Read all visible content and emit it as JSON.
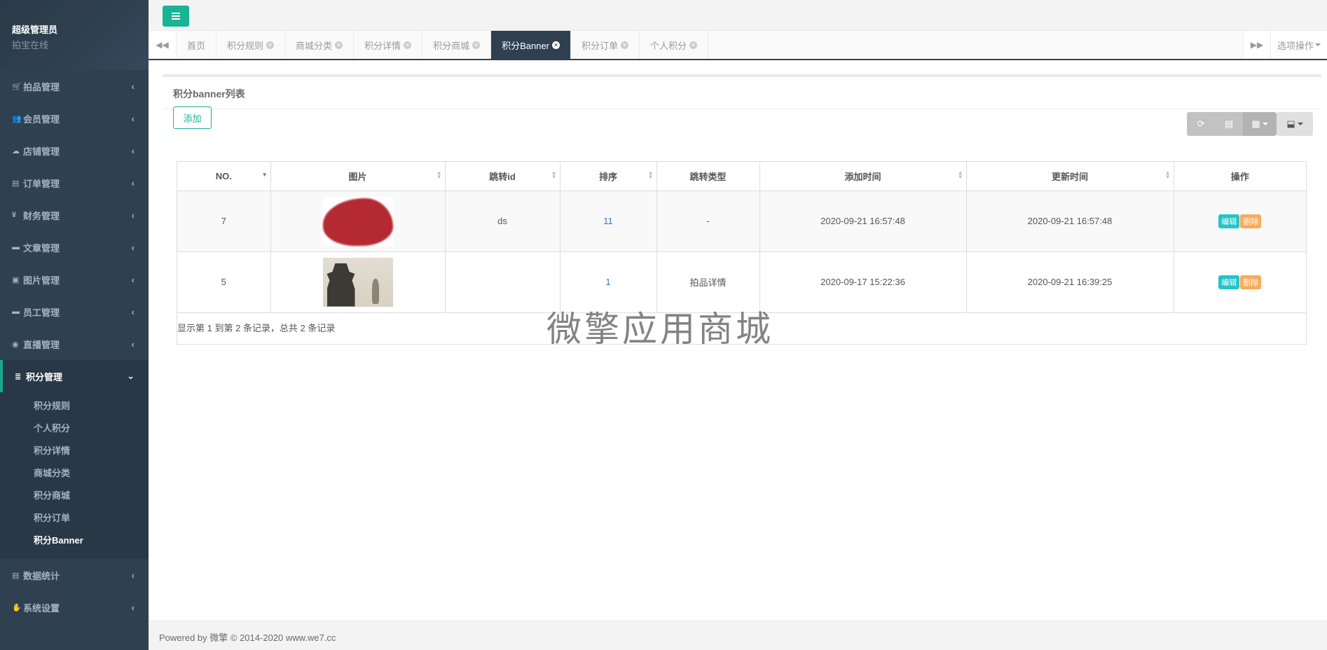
{
  "profile": {
    "name": "超级管理员",
    "role": "拍宝在线"
  },
  "sidebar": {
    "items": [
      {
        "icon": "🛒",
        "label": "拍品管理"
      },
      {
        "icon": "👥",
        "label": "会员管理"
      },
      {
        "icon": "☁",
        "label": "店铺管理"
      },
      {
        "icon": "▤",
        "label": "订单管理"
      },
      {
        "icon": "¥",
        "label": "财务管理"
      },
      {
        "icon": "▬",
        "label": "文章管理"
      },
      {
        "icon": "▣",
        "label": "图片管理"
      },
      {
        "icon": "▬",
        "label": "员工管理"
      },
      {
        "icon": "◉",
        "label": "直播管理"
      }
    ],
    "active": {
      "icon": "≣",
      "label": "积分管理"
    },
    "submenu": [
      "积分规则",
      "个人积分",
      "积分详情",
      "商城分类",
      "积分商城",
      "积分订单",
      "积分Banner"
    ],
    "bottom_items": [
      {
        "icon": "▤",
        "label": "数据统计"
      },
      {
        "icon": "✋",
        "label": "系统设置"
      }
    ]
  },
  "tabs": [
    {
      "label": "首页"
    },
    {
      "label": "积分规则"
    },
    {
      "label": "商城分类"
    },
    {
      "label": "积分详情"
    },
    {
      "label": "积分商城"
    },
    {
      "label": "积分Banner"
    },
    {
      "label": "积分订单"
    },
    {
      "label": "个人积分"
    }
  ],
  "options_label": "选项操作",
  "panel": {
    "title": "积分banner列表",
    "add_label": "添加"
  },
  "table": {
    "headers": [
      "NO.",
      "图片",
      "跳转id",
      "排序",
      "跳转类型",
      "添加时间",
      "更新时间",
      "操作"
    ],
    "rows": [
      {
        "no": "7",
        "image": "red-blob",
        "jump_id": "ds",
        "sort": "11",
        "jump_type": "-",
        "created": "2020-09-21 16:57:48",
        "updated": "2020-09-21 16:57:48"
      },
      {
        "no": "5",
        "image": "pagoda-photo",
        "jump_id": "",
        "sort": "1",
        "jump_type": "拍品详情",
        "created": "2020-09-17 15:22:36",
        "updated": "2020-09-21 16:39:25"
      }
    ],
    "edit_label": "编辑",
    "delete_label": "删除",
    "pagination": "显示第 1 到第 2 条记录，总共 2 条记录"
  },
  "watermark": "微擎应用商城",
  "footer": "Powered by 微擎 © 2014-2020 www.we7.cc",
  "colors": {
    "sidebar": "#2f4050",
    "accent": "#1ab394",
    "edit": "#23c6c8",
    "delete": "#f8ac59"
  }
}
